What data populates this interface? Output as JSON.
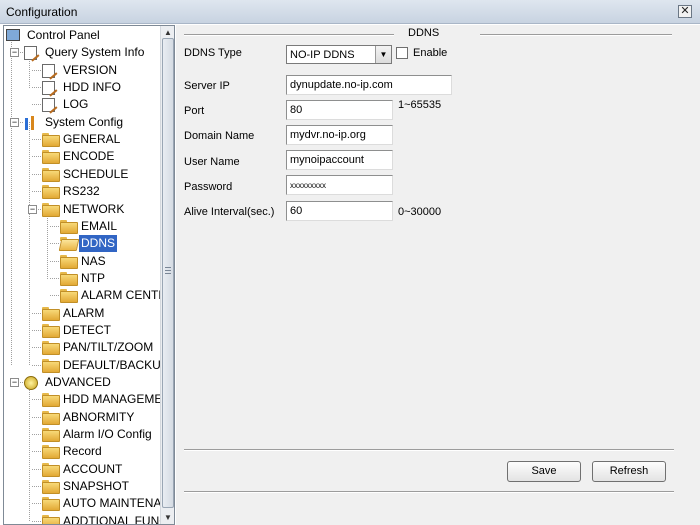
{
  "window": {
    "title": "Configuration",
    "close_glyph": "✕"
  },
  "tree": {
    "items": [
      {
        "key": "control_panel",
        "label": "Control Panel",
        "icon": "computer-icon"
      },
      {
        "key": "query_system_info",
        "label": "Query System Info",
        "icon": "document-edit-icon",
        "expanded": true
      },
      {
        "key": "version",
        "label": "VERSION",
        "icon": "document-edit-icon"
      },
      {
        "key": "hdd_info",
        "label": "HDD INFO",
        "icon": "document-edit-icon"
      },
      {
        "key": "log",
        "label": "LOG",
        "icon": "document-edit-icon"
      },
      {
        "key": "system_config",
        "label": "System Config",
        "icon": "config-icon",
        "expanded": true
      },
      {
        "key": "general",
        "label": "GENERAL",
        "icon": "folder-icon"
      },
      {
        "key": "encode",
        "label": "ENCODE",
        "icon": "folder-icon"
      },
      {
        "key": "schedule",
        "label": "SCHEDULE",
        "icon": "folder-icon"
      },
      {
        "key": "rs232",
        "label": "RS232",
        "icon": "folder-icon"
      },
      {
        "key": "network",
        "label": "NETWORK",
        "icon": "folder-icon",
        "expanded": true
      },
      {
        "key": "email",
        "label": "EMAIL",
        "icon": "folder-icon"
      },
      {
        "key": "ddns",
        "label": "DDNS",
        "icon": "folder-open-icon",
        "selected": true
      },
      {
        "key": "nas",
        "label": "NAS",
        "icon": "folder-icon"
      },
      {
        "key": "ntp",
        "label": "NTP",
        "icon": "folder-icon"
      },
      {
        "key": "alarm_center",
        "label": "ALARM CENTE",
        "icon": "folder-icon"
      },
      {
        "key": "alarm",
        "label": "ALARM",
        "icon": "folder-icon"
      },
      {
        "key": "detect",
        "label": "DETECT",
        "icon": "folder-icon"
      },
      {
        "key": "pan_tilt_zoom",
        "label": "PAN/TILT/ZOOM",
        "icon": "folder-icon"
      },
      {
        "key": "default_backup",
        "label": "DEFAULT/BACKUP",
        "icon": "folder-icon"
      },
      {
        "key": "advanced",
        "label": "ADVANCED",
        "icon": "advanced-icon",
        "expanded": true
      },
      {
        "key": "hdd_management",
        "label": "HDD MANAGEMEI",
        "icon": "folder-icon"
      },
      {
        "key": "abnormity",
        "label": "ABNORMITY",
        "icon": "folder-icon"
      },
      {
        "key": "alarm_io_config",
        "label": "Alarm I/O Config",
        "icon": "folder-icon"
      },
      {
        "key": "record",
        "label": "Record",
        "icon": "folder-icon"
      },
      {
        "key": "account",
        "label": "ACCOUNT",
        "icon": "folder-icon"
      },
      {
        "key": "snapshot",
        "label": "SNAPSHOT",
        "icon": "folder-icon"
      },
      {
        "key": "auto_maintenance",
        "label": "AUTO MAINTENAI",
        "icon": "folder-icon"
      },
      {
        "key": "additional_function",
        "label": "ADDTIONAL FUNCTIC",
        "icon": "folder-icon"
      }
    ],
    "scroll_up": "▲",
    "scroll_down": "▼",
    "expand_glyph": "−"
  },
  "ddns": {
    "section_title": "DDNS",
    "type_label": "DDNS Type",
    "type_value": "NO-IP DDNS",
    "dropdown_glyph": "▼",
    "enable_label": "Enable",
    "enable_checked": false,
    "server_ip_label": "Server IP",
    "server_ip_value": "dynupdate.no-ip.com",
    "port_label": "Port",
    "port_value": "80",
    "port_range": "1~65535",
    "domain_label": "Domain Name",
    "domain_value": "mydvr.no-ip.org",
    "user_label": "User Name",
    "user_value": "mynoipaccount",
    "password_label": "Password",
    "password_value": "xxxxxxxxx",
    "alive_label": "Alive Interval(sec.)",
    "alive_value": "60",
    "alive_range": "0~30000"
  },
  "buttons": {
    "save": "Save",
    "refresh": "Refresh"
  }
}
